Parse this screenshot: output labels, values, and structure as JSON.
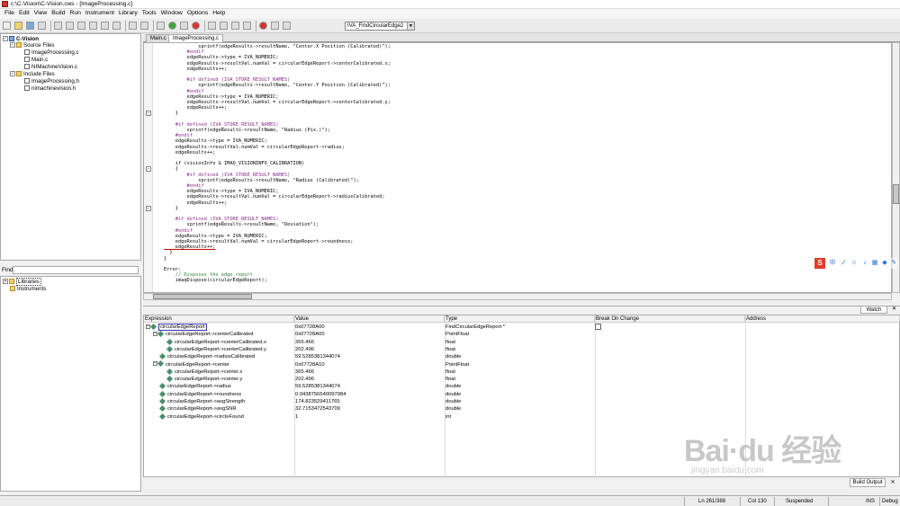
{
  "titlebar": {
    "text": "c:\\C-Vision\\C-Vision.cws - [ImageProcessing.c]"
  },
  "menu": [
    "File",
    "Edit",
    "View",
    "Build",
    "Run",
    "Instrument",
    "Library",
    "Tools",
    "Window",
    "Options",
    "Help"
  ],
  "toolbar": {
    "function_select": "IVA_FindCircularEdge2"
  },
  "tree": {
    "project": "C-Vision",
    "source_folder": "Source Files",
    "source_files": [
      "ImageProcessing.c",
      "Main.c",
      "NIMachineVision.c"
    ],
    "include_folder": "Include Files",
    "include_files": [
      "ImageProcessing.h",
      "nimachinevision.h"
    ]
  },
  "find": {
    "label": "Find"
  },
  "libraries": {
    "items": [
      "Libraries",
      "Instruments"
    ]
  },
  "tabs": [
    "Main.c",
    "ImageProcessing.c"
  ],
  "code": [
    "            sprintf(edgeResults->resultName, \"Center.X Position (Calibrated)\");",
    "        #endif",
    "        edgeResults->type = IVA_NUMERIC;",
    "        edgeResults->resultVal.numVal = circularEdgeReport->centerCalibrated.x;",
    "        edgeResults++;",
    "",
    "        #if defined (IVA_STORE_RESULT_NAMES)",
    "            sprintf(edgeResults->resultName, \"Center.Y Position (Calibrated)\");",
    "        #endif",
    "        edgeResults->type = IVA_NUMERIC;",
    "        edgeResults->resultVal.numVal = circularEdgeReport->centerCalibrated.y;",
    "        edgeResults++;",
    "    }",
    "",
    "    #if defined (IVA_STORE_RESULT_NAMES)",
    "        sprintf(edgeResults->resultName, \"Radius (Pix.)\");",
    "    #endif",
    "    edgeResults->type = IVA_NUMERIC;",
    "    edgeResults->resultVal.numVal = circularEdgeReport->radius;",
    "    edgeResults++;",
    "",
    "    if (visionInfo & IMAQ_VISIONINFO_CALIBRATION)",
    "    {",
    "        #if defined (IVA_STORE_RESULT_NAMES)",
    "            sprintf(edgeResults->resultName, \"Radius (Calibrated)\");",
    "        #endif",
    "        edgeResults->type = IVA_NUMERIC;",
    "        edgeResults->resultVal.numVal = circularEdgeReport->radiusCalibrated;",
    "        edgeResults++;",
    "    }",
    "",
    "    #if defined (IVA_STORE_RESULT_NAMES)",
    "        sprintf(edgeResults->resultName, \"Deviation\");",
    "    #endif",
    "    edgeResults->type = IVA_NUMERIC;",
    "    edgeResults->resultVal.numVal = circularEdgeReport->roundness;",
    "    edgeResults++;",
    "  }",
    "}",
    "",
    "Error:",
    "    // Disposes the edge report",
    "    imaqDispose(circularEdgeReport);"
  ],
  "watch": {
    "tab_label": "Watch",
    "columns": [
      "Expression",
      "Value",
      "Type",
      "Break On Change",
      "Address"
    ],
    "rows": [
      {
        "expr": "circularEdgeReport",
        "value": "0x07728A00",
        "type": "FindCircularEdgeReport *"
      },
      {
        "expr": "circularEdgeReport->centerCalibrated",
        "value": "0x07728A00",
        "type": "PointFloat"
      },
      {
        "expr": "circularEdgeReport->centerCalibrated.x",
        "value": "365.466",
        "type": "float"
      },
      {
        "expr": "circularEdgeReport->centerCalibrated.y",
        "value": "202.496",
        "type": "float"
      },
      {
        "expr": "circularEdgeReport->radiusCalibrated",
        "value": "59.5285381344074",
        "type": "double"
      },
      {
        "expr": "circularEdgeReport->center",
        "value": "0x07728A10",
        "type": "PointFloat"
      },
      {
        "expr": "circularEdgeReport->center.x",
        "value": "365.466",
        "type": "float"
      },
      {
        "expr": "circularEdgeReport->center.y",
        "value": "202.496",
        "type": "float"
      },
      {
        "expr": "circularEdgeReport->radius",
        "value": "59.5285381344074",
        "type": "double"
      },
      {
        "expr": "circularEdgeReport->roundness",
        "value": "0.0438756540097984",
        "type": "double"
      },
      {
        "expr": "circularEdgeReport->avgStrength",
        "value": "174.823529411765",
        "type": "double"
      },
      {
        "expr": "circularEdgeReport->avgSNR",
        "value": "32.7153472543709",
        "type": "double"
      },
      {
        "expr": "circularEdgeReport->circleFound",
        "value": "1",
        "type": "int"
      }
    ]
  },
  "build_output": {
    "label": "Build Output"
  },
  "status": {
    "position": "Ln 261/388",
    "column": "Col 130",
    "state": "Suspended",
    "mode": "INS",
    "config": "Debug"
  },
  "watermark": {
    "logo": "Bai·du 经验",
    "url": "jingyan.baidu.com"
  }
}
